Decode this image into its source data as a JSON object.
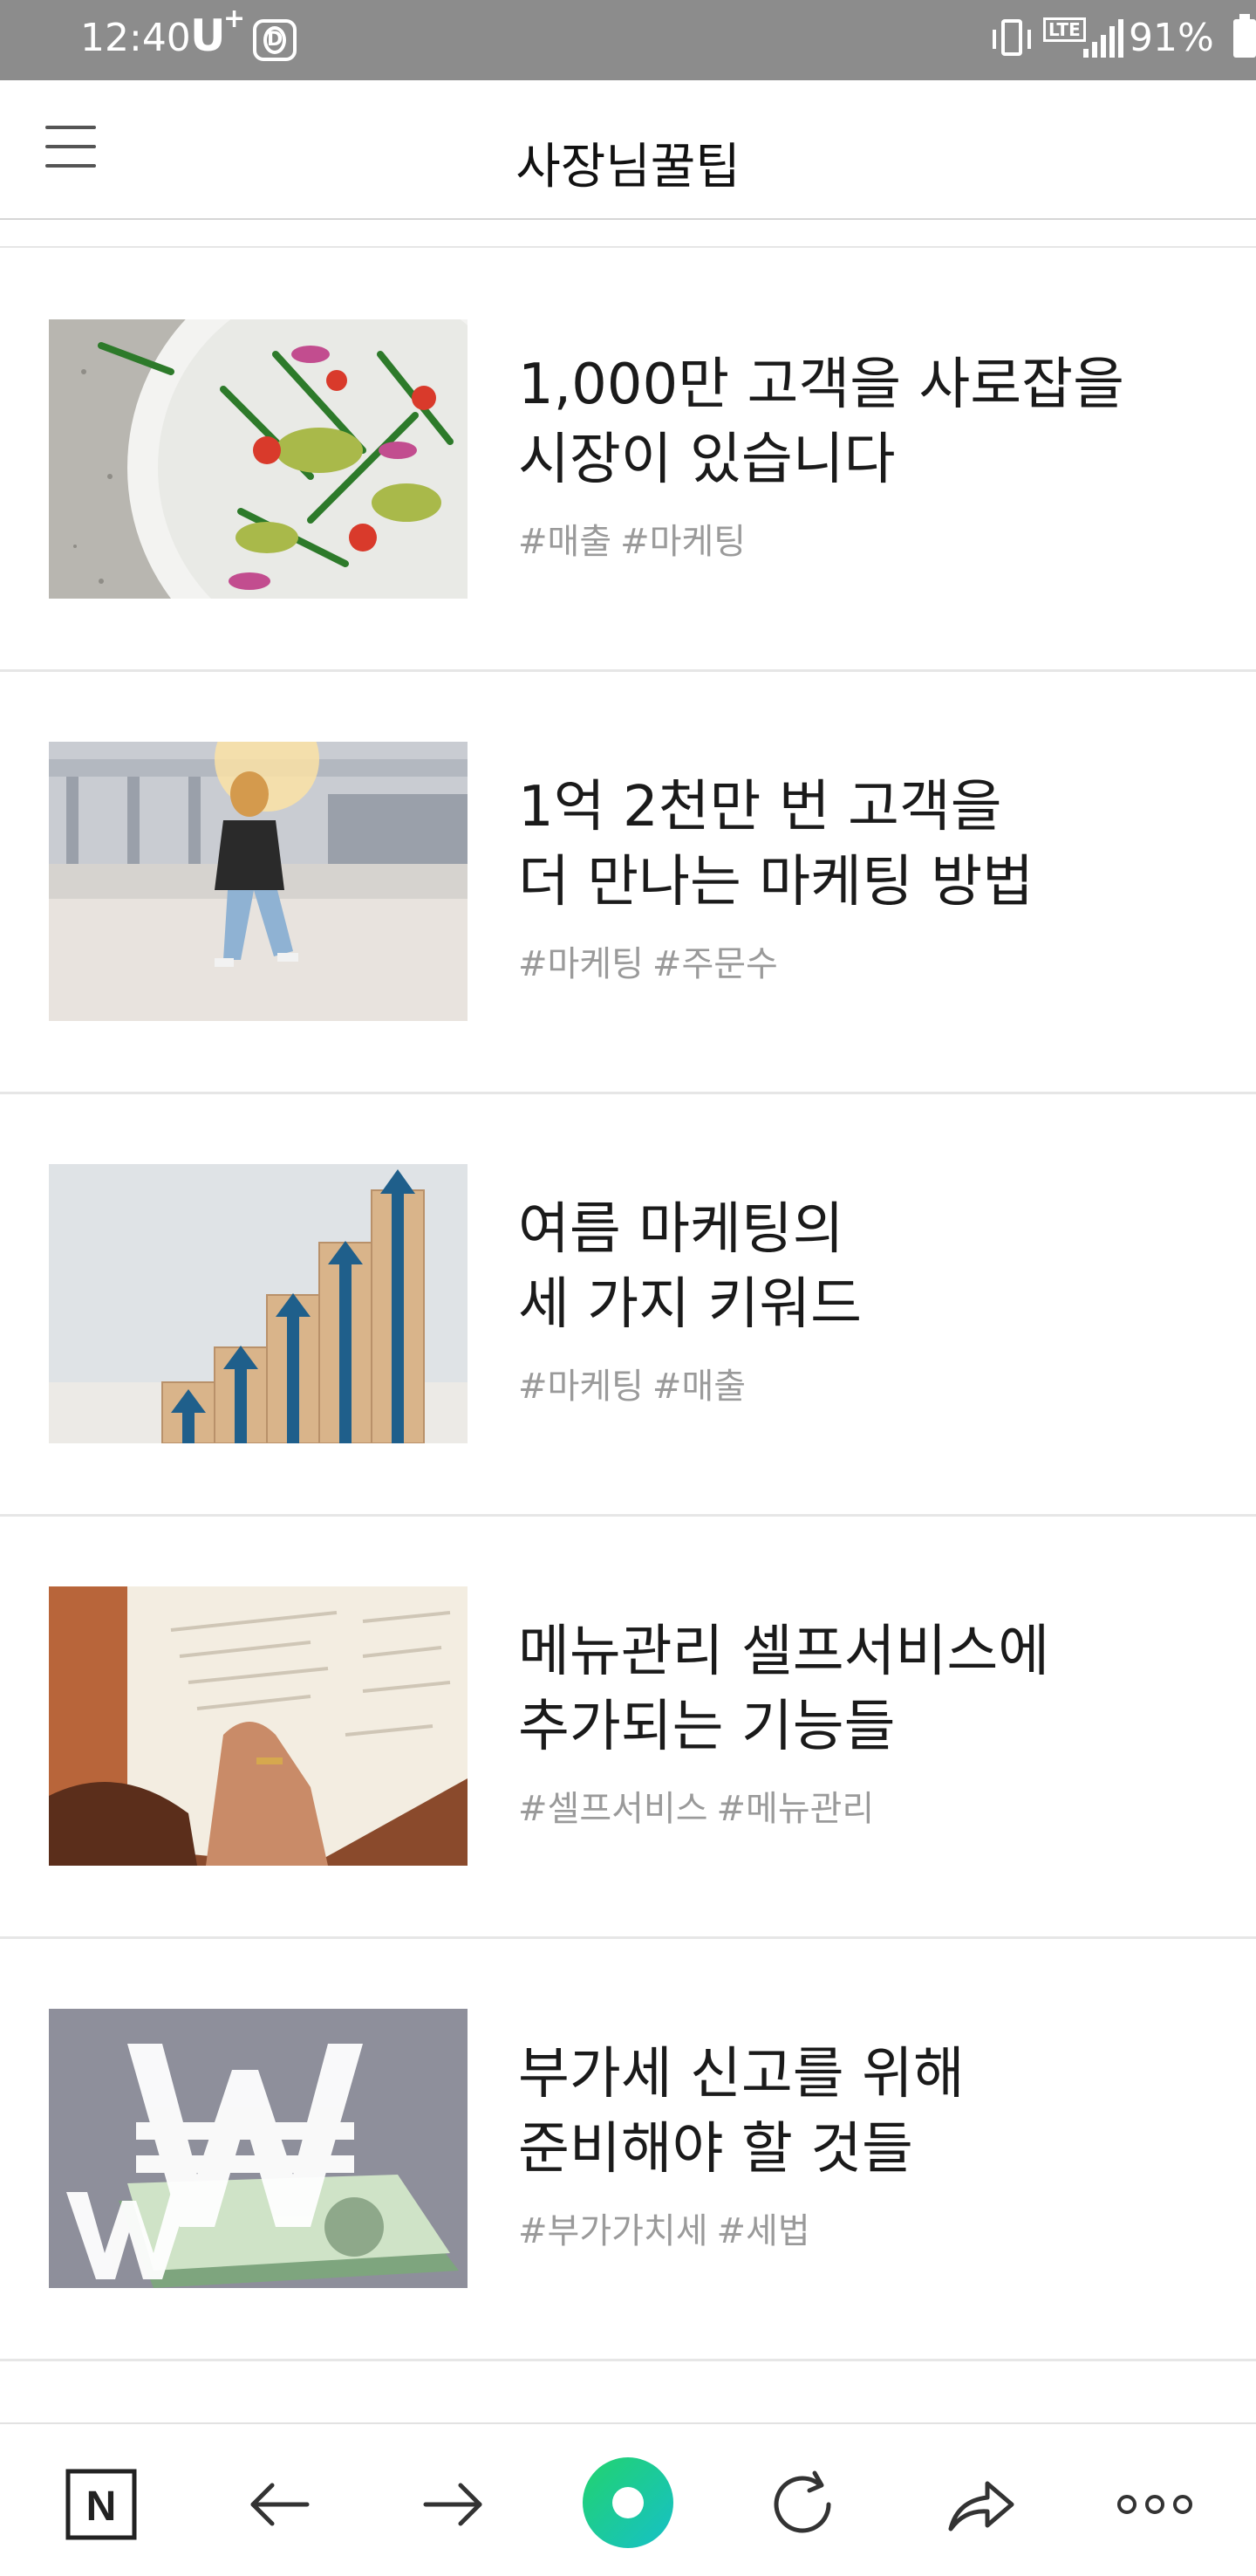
{
  "status_bar": {
    "time": "12:40",
    "carrier": "U",
    "carrier_plus": "+",
    "d_badge": "D",
    "network": "LTE",
    "battery_percent": "91%"
  },
  "header": {
    "title": "사장님꿀팁"
  },
  "articles": [
    {
      "title": "1,000만 고객을 사로잡을\n시장이 있습니다",
      "tags": [
        "#매출",
        "#마케팅"
      ]
    },
    {
      "title": "1억 2천만 번 고객을\n더 만나는 마케팅 방법",
      "tags": [
        "#마케팅",
        "#주문수"
      ]
    },
    {
      "title": "여름 마케팅의\n세 가지 키워드",
      "tags": [
        "#마케팅",
        "#매출"
      ]
    },
    {
      "title": "메뉴관리 셀프서비스에\n추가되는 기능들",
      "tags": [
        "#셀프서비스",
        "#메뉴관리"
      ]
    },
    {
      "title": "부가세 신고를 위해\n준비해야 할 것들",
      "tags": [
        "#부가가치세",
        "#세법"
      ]
    }
  ],
  "toolbar": {
    "home_glyph": "N",
    "icons": [
      "naver-home-icon",
      "back-arrow-icon",
      "forward-arrow-icon",
      "green-dot-icon",
      "refresh-icon",
      "share-icon",
      "more-icon"
    ]
  },
  "colors": {
    "status_bar_bg": "#8c8c8c",
    "tag_text": "#9a9a9a",
    "green_accent": "#1ec8a0",
    "divider": "#e6e6e6"
  }
}
